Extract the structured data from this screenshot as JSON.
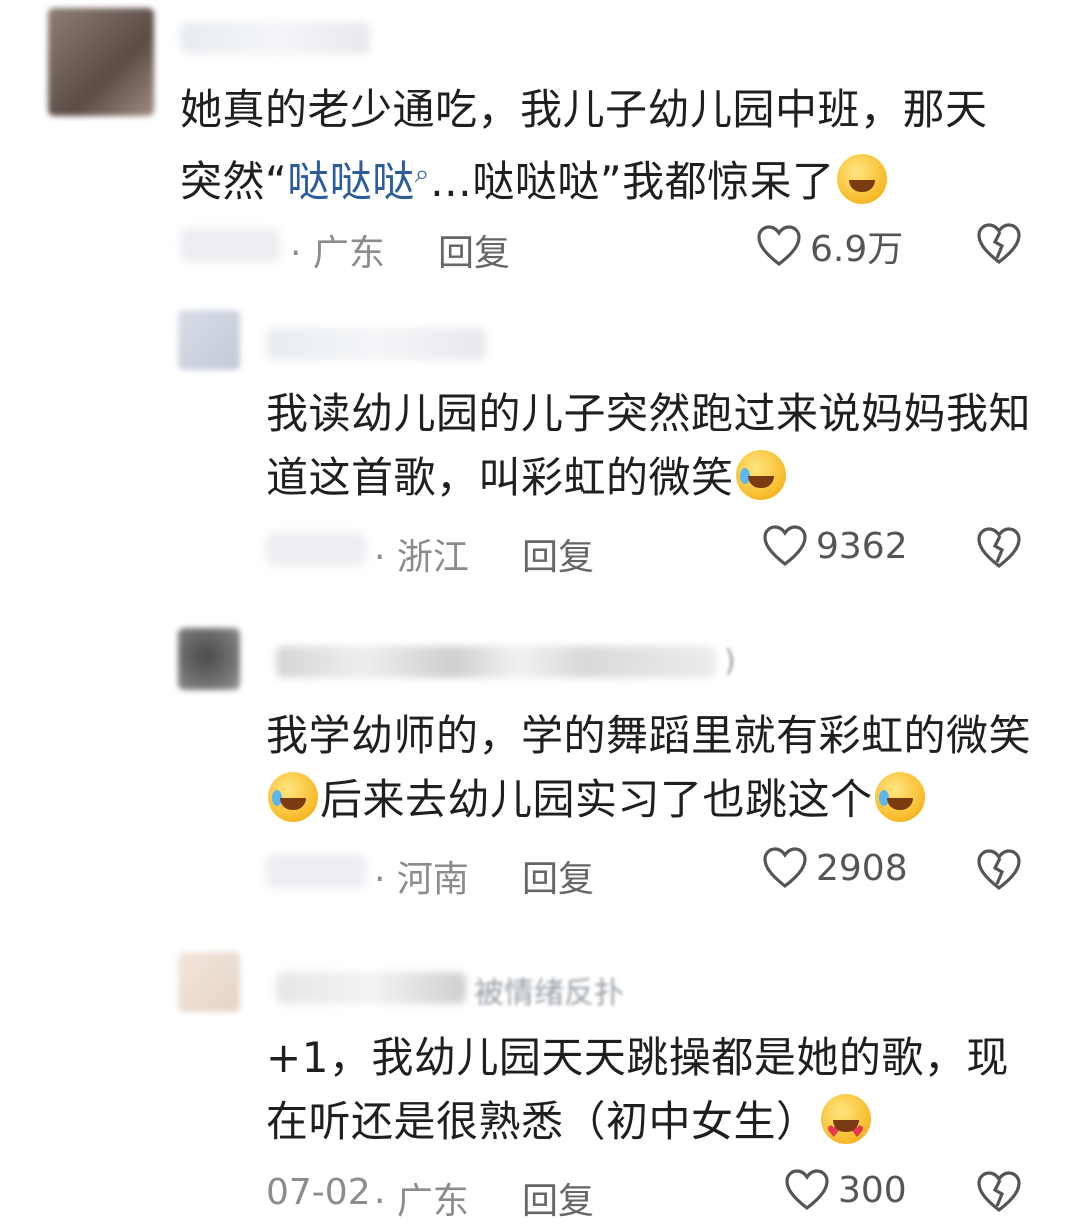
{
  "comments": [
    {
      "text_pre": "她真的老少通吃，我儿子幼儿园中班，那天突然“",
      "highlight": "哒哒哒",
      "search_mark": "⌕",
      "text_post": "…哒哒哒”我都惊呆了",
      "location": "· 广东",
      "reply": "回复",
      "likes": "6.9万"
    },
    {
      "text": "我读幼儿园的儿子突然跑过来说妈妈我知道这首歌，叫彩虹的微笑",
      "location": "· 浙江",
      "reply": "回复",
      "likes": "9362"
    },
    {
      "name_fragment": ")",
      "text_a": "我学幼师的，学的舞蹈里就有彩虹的微笑",
      "text_b": "后来去幼儿园实习了也跳这个",
      "location": "· 河南",
      "reply": "回复",
      "likes": "2908"
    },
    {
      "name_fragment": "被情绪反扑",
      "text": "+1，我幼儿园天天跳操都是她的歌，现在听还是很熟悉（初中女生）",
      "date": "07-02",
      "location": "· 广东",
      "reply": "回复",
      "likes": "300"
    }
  ],
  "icons": {
    "like": "heart-outline-icon",
    "dislike": "broken-heart-icon",
    "emoji_sweat_grin": "grinning-sweat-emoji",
    "emoji_rofl": "rolling-laughing-emoji",
    "emoji_heart_eyes": "heart-eyes-emoji"
  },
  "colors": {
    "highlight_link": "#2d5c9c",
    "meta_gray": "#8c8c8c"
  }
}
